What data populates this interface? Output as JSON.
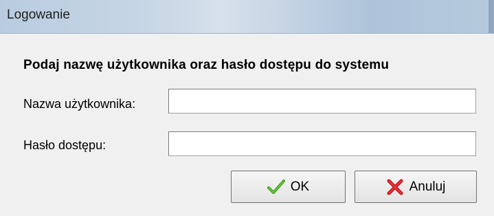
{
  "window": {
    "title": "Logowanie"
  },
  "form": {
    "heading": "Podaj nazwę użytkownika oraz hasło dostępu do systemu",
    "username_label": "Nazwa użytkownika:",
    "username_value": "",
    "password_label": "Hasło dostępu:",
    "password_value": ""
  },
  "buttons": {
    "ok_label": "OK",
    "ok_icon": "checkmark-icon",
    "cancel_label": "Anuluj",
    "cancel_icon": "cross-icon"
  },
  "colors": {
    "ok_icon": "#3a9a1a",
    "cancel_icon": "#c8101a"
  }
}
